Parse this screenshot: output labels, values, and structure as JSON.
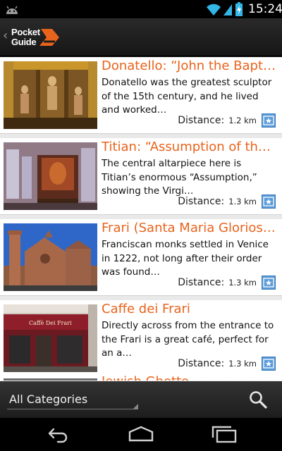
{
  "status_bar": {
    "time": "15:24",
    "icons": [
      "android-icon",
      "wifi-icon",
      "signal-icon",
      "battery-charging-icon"
    ]
  },
  "action_bar": {
    "logo_line1": "Pocket",
    "logo_line2": "Guide",
    "accent_color": "#e8631c"
  },
  "list": {
    "distance_label": "Distance:",
    "items": [
      {
        "title": "Donatello: “John the Baptist”",
        "description": "Donatello was the greatest sculptor of the 15th century, and he lived and worked…",
        "distance": "1.2 km"
      },
      {
        "title": "Titian: “Assumption of the Virgin”",
        "description": "The central altarpiece here is Titian’s enormous “Assumption,” showing the Virgi…",
        "distance": "1.3 km"
      },
      {
        "title": "Frari (Santa Maria Gloriosa dei Frari)",
        "description": "Franciscan monks settled in Venice in 1222, not long after their order was found…",
        "distance": "1.3 km"
      },
      {
        "title": "Caffe dei Frari",
        "description": "Directly across from the entrance to the Frari is a great café, perfect for an a…",
        "distance": "1.3 km",
        "sign_text": "Caffè Dei Frari"
      },
      {
        "title": "Jewish Ghetto",
        "description": "",
        "distance": ""
      }
    ]
  },
  "filter_bar": {
    "category_selected": "All Categories"
  },
  "nav_bar": {
    "buttons": [
      "back-icon",
      "home-icon",
      "recent-apps-icon"
    ]
  }
}
